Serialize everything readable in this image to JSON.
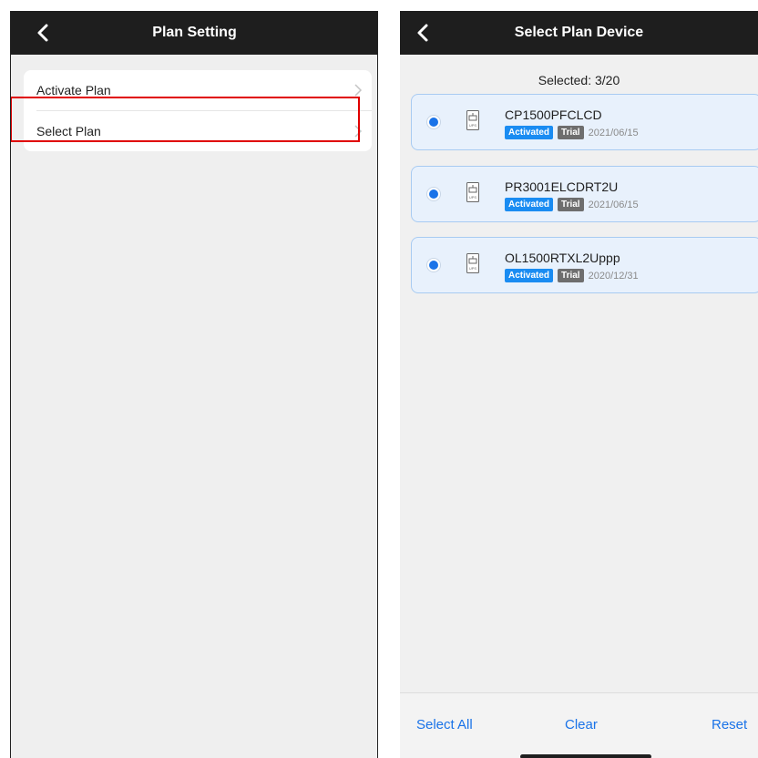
{
  "left_screen": {
    "title": "Plan Setting",
    "menu": [
      {
        "label": "Activate Plan"
      },
      {
        "label": "Select Plan"
      }
    ]
  },
  "right_screen": {
    "title": "Select Plan Device",
    "selected_text": "Selected: 3/20",
    "devices": [
      {
        "name": "CP1500PFCLCD",
        "status": "Activated",
        "type": "Trial",
        "date": "2021/06/15",
        "selected": true,
        "icon": "ups-icon"
      },
      {
        "name": "PR3001ELCDRT2U",
        "status": "Activated",
        "type": "Trial",
        "date": "2021/06/15",
        "selected": true,
        "icon": "ups-icon"
      },
      {
        "name": "OL1500RTXL2Uppp",
        "status": "Activated",
        "type": "Trial",
        "date": "2020/12/31",
        "selected": true,
        "icon": "ups-icon"
      }
    ],
    "bottom_bar": {
      "select_all": "Select All",
      "clear": "Clear",
      "reset": "Reset"
    }
  },
  "colors": {
    "accent": "#1a73e8",
    "highlight_box": "#e00000",
    "activated_badge": "#1a8cf2",
    "trial_badge": "#6e6e6e",
    "navbar": "#1e1e1e"
  }
}
